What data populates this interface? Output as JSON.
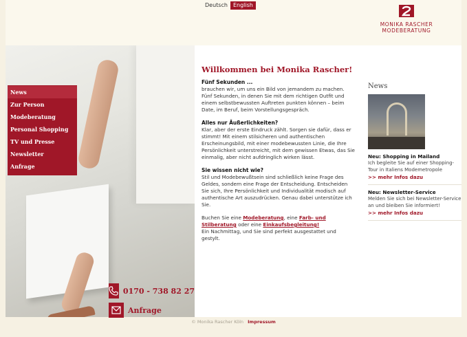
{
  "header": {
    "languages": [
      "Deutsch",
      "English"
    ],
    "logo_line1": "MONIKA RASCHER",
    "logo_line2": "MODEBERATUNG"
  },
  "nav": {
    "items": [
      "News",
      "Zur Person",
      "Modeberatung",
      "Personal Shopping",
      "TV und Presse",
      "Newsletter",
      "Anfrage"
    ]
  },
  "contact": {
    "phone": "0170 - 738 82 27",
    "request": "Anfrage"
  },
  "content": {
    "title": "Willkommen bei Monika Rascher!",
    "sections": [
      {
        "heading": "Fünf Sekunden ...",
        "text": "brauchen wir, um uns ein Bild von jemandem zu machen. Fünf Sekunden, in denen Sie mit dem richtigen Outfit und einem selbstbewussten Auftreten punkten können – beim Date, im Beruf, beim Vorstellungsgespräch."
      },
      {
        "heading": "Alles nur Äußerlichkeiten?",
        "text": "Klar, aber der erste Eindruck zählt. Sorgen sie dafür, dass er stimmt! Mit einem stilsicheren und authentischen Erscheinungsbild, mit einer modebewussten Linie, die Ihre Persönlichkeit unterstreicht, mit dem gewissen Etwas, das Sie einmalig, aber nicht aufdringlich wirken lässt."
      },
      {
        "heading": "Sie wissen nicht wie?",
        "text": "Stil und Modebewußtsein sind schließlich keine Frage des Geldes, sondern eine Frage der Entscheidung. Entscheiden Sie sich, Ihre Persönlichkeit und Individualität modisch auf authentische Art auszudrücken. Genau dabei unterstütze ich Sie."
      }
    ],
    "closing": {
      "prefix": "Buchen Sie eine",
      "link1": "Modeberatung",
      "mid1": ", eine",
      "link2": "Farb- und Stilberatung",
      "mid2": "oder eine",
      "link3": "Einkaufsbegleitung!",
      "suffix": "Ein Nachmittag, und Sie sind perfekt ausgestattet und gestylt."
    }
  },
  "news": {
    "title": "News",
    "items": [
      {
        "heading": "Neu: Shopping in Mailand",
        "text": "Ich begleite Sie auf einer Shopping-Tour in Italiens Modemetropole",
        "link": ">> mehr Infos dazu"
      },
      {
        "heading": "Neu: Newsletter-Service",
        "text": "Melden Sie sich bei Newsletter-Service an und bleiben Sie informiert!",
        "link": ">> mehr Infos dazu"
      }
    ]
  },
  "footer": {
    "copyright": "© Monika Rascher Köln",
    "impressum": "Impressum"
  },
  "colors": {
    "brand": "#a01728",
    "background": "#f6f1e3"
  }
}
